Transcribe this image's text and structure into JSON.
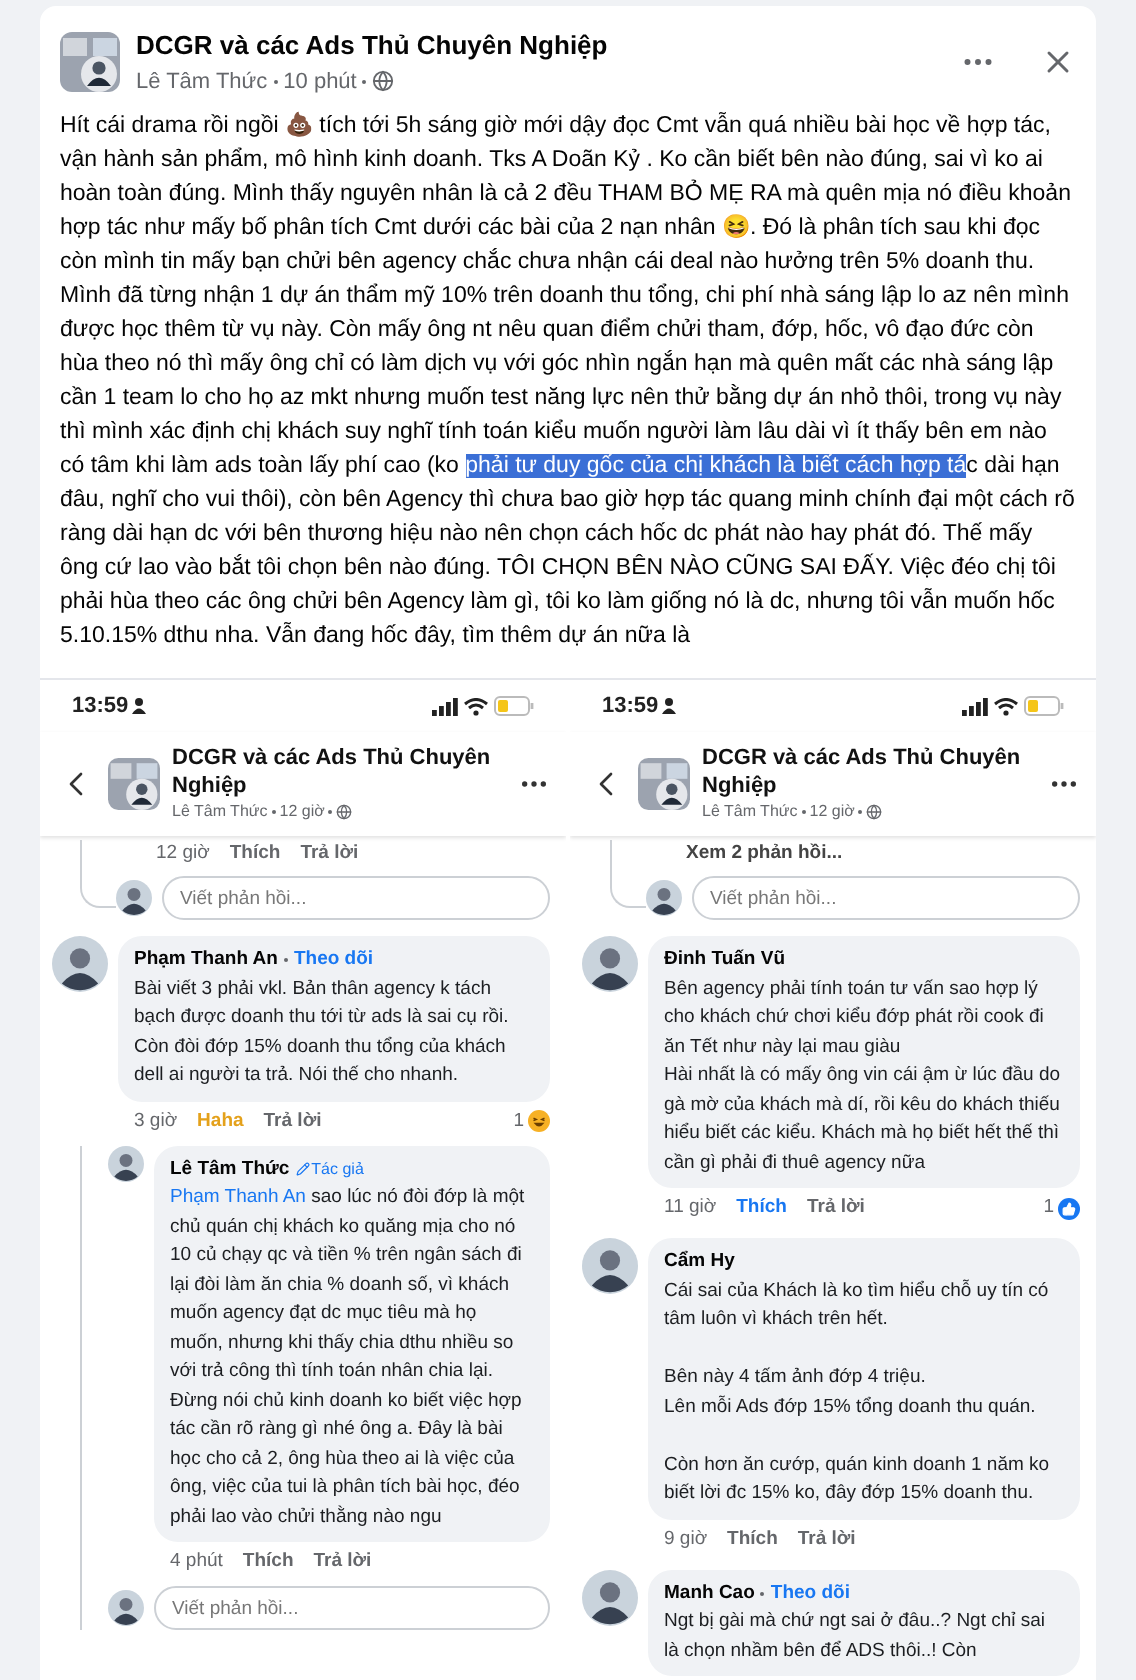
{
  "post": {
    "group": "DCGR và các Ads Thủ Chuyên Nghiệp",
    "author": "Lê Tâm Thức",
    "time": "10 phút",
    "text_before": "Hít cái drama rồi ngồi 💩 tích tới 5h sáng giờ mới dậy đọc Cmt vẫn quá nhiều bài học về hợp tác, vận hành sản phẩm, mô hình kinh doanh. Tks A Doãn Kỷ . Ko cần biết bên nào đúng, sai vì ko ai hoàn toàn đúng. Mình thấy nguyên nhân là cả 2 đều THAM BỎ MẸ RA mà quên mịa nó điều khoản hợp tác như mấy bố phân tích Cmt dưới các bài của 2 nạn nhân 😆. Đó là phân tích sau khi đọc còn mình tin mấy bạn chửi bên agency chắc chưa nhận cái deal nào hưởng trên 5% doanh thu. Mình đã từng nhận 1 dự án thẩm mỹ 10% trên doanh thu tổng, chi phí nhà sáng lập lo az nên mình được học thêm từ vụ này. Còn mấy ông nt nêu quan điểm chửi tham, đớp, hốc, vô đạo đức còn hùa theo nó thì mấy ông chỉ có làm dịch vụ với góc nhìn ngắn hạn mà quên mất các nhà sáng lập cần 1 team lo cho họ az mkt nhưng muốn test năng lực nên thử bằng dự án nhỏ thôi, trong vụ này thì mình xác định chị khách suy nghĩ tính toán kiểu muốn người làm lâu dài vì ít thấy bên em nào có tâm khi làm ads toàn lấy phí cao (ko ",
    "selection": "phải tư duy gốc của chị khách là biết cách hợp tá",
    "text_after": "c dài hạn đâu, nghĩ cho vui thôi), còn bên Agency thì chưa bao giờ hợp tác quang minh chính đại một cách rõ ràng dài hạn dc với bên thương hiệu nào nên chọn cách hốc dc phát nào hay phát đó. Thế mấy ông cứ lao vào bắt tôi chọn bên nào đúng. TÔI CHỌN BÊN NÀO CŨNG SAI ĐẤY. Việc đéo chị tôi phải hùa theo các ông chửi bên Agency làm gì, tôi ko làm giống nó là dc, nhưng tôi vẫn muốn hốc 5.10.15% dthu nha. Vẫn đang hốc đây, tìm thêm dự án nữa là"
  },
  "screenshots": [
    {
      "status_time": "13:59",
      "group": "DCGR và các Ads Thủ Chuyên Nghiệp",
      "author": "Lê Tâm Thức",
      "time": "12 giờ",
      "items": [
        {
          "kind": "thread_tail",
          "children": [
            {
              "kind": "actions",
              "time": "12 giờ",
              "like": "Thích",
              "reply": "Trả lời"
            },
            {
              "kind": "reply_box",
              "placeholder": "Viết phản hồi..."
            }
          ]
        },
        {
          "kind": "comment",
          "name": "Phạm Thanh An",
          "follow": "Theo dõi",
          "text": "Bài viết 3 phải vkl. Bản thân agency k tách bạch được doanh thu tới từ ads là sai cụ rồi. Còn đòi đớp 15% doanh thu tổng của khách dell ai người ta trả. Nói thế cho nhanh.",
          "time": "3 giờ",
          "like": "Haha",
          "liked": true,
          "laughing": true,
          "count": "1",
          "reply": "Trả lời",
          "children": [
            {
              "kind": "comment",
              "name": "Lê Tâm Thức",
              "badge": "Tác giả",
              "mention": "Phạm Thanh An",
              "text": "sao lúc nó đòi đớp là một chủ quán chị khách ko quăng mịa cho nó 10 củ chạy qc và tiền % trên ngân sách đi lại đòi làm ăn chia % doanh số, vì khách muốn agency đạt dc mục tiêu mà họ muốn, nhưng khi thấy chia dthu nhiều so với trả công thì tính toán nhân chia lại. Đừng nói chủ kinh doanh ko biết việc hợp tác cần rõ ràng gì nhé ông a. Đây là bài học cho cả 2, ông hùa theo ai là việc của ông, việc của tui là phân tích bài học, đéo phải lao vào chửi thằng nào ngu",
              "time": "4 phút",
              "like": "Thích",
              "liked": false,
              "reply": "Trả lời"
            },
            {
              "kind": "reply_box",
              "placeholder": "Viết phản hồi..."
            }
          ]
        }
      ]
    },
    {
      "status_time": "13:59",
      "group": "DCGR và các Ads Thủ Chuyên Nghiệp",
      "author": "Lê Tâm Thức",
      "time": "12 giờ",
      "items": [
        {
          "kind": "thread_tail",
          "children": [
            {
              "kind": "more",
              "text": "Xem 2 phản hồi..."
            },
            {
              "kind": "reply_box",
              "placeholder": "Viết phản hồi..."
            }
          ]
        },
        {
          "kind": "comment",
          "name": "Đinh Tuấn Vũ",
          "text": "Bên agency phải tính toán tư vấn sao hợp lý cho khách chứ chơi kiểu đớp phát rồi cook đi ăn Tết như này lại mau giàu\nHài nhất là có mấy ông vin cái ậm ừ lúc đầu do gà mờ của khách mà dí, rồi kêu do khách thiếu hiểu biết các kiểu. Khách mà họ biết hết thế thì cần gì phải đi thuê agency nữa",
          "time": "11 giờ",
          "like": "Thích",
          "liked": true,
          "laughing": false,
          "count": "1",
          "reply": "Trả lời"
        },
        {
          "kind": "comment",
          "name": "Cẩm Hy",
          "text": "Cái sai của Khách là ko tìm hiểu chỗ uy tín có tâm luôn vì khách trên hết.\n\nBên này 4 tấm ảnh đớp 4 triệu.\nLên mỗi Ads đớp 15% tổng doanh thu quán.\n\nCòn hơn ăn cướp, quán kinh doanh 1 năm ko biết lời đc 15% ko, đây đớp 15% doanh thu.",
          "time": "9 giờ",
          "like": "Thích",
          "liked": false,
          "reply": "Trả lời"
        },
        {
          "kind": "comment",
          "name": "Manh Cao",
          "follow": "Theo dõi",
          "text": "Ngt bị gài mà chứ ngt sai ở đâu..? Ngt chỉ sai là chọn nhầm bên để ADS thôi..! Còn"
        }
      ]
    }
  ]
}
